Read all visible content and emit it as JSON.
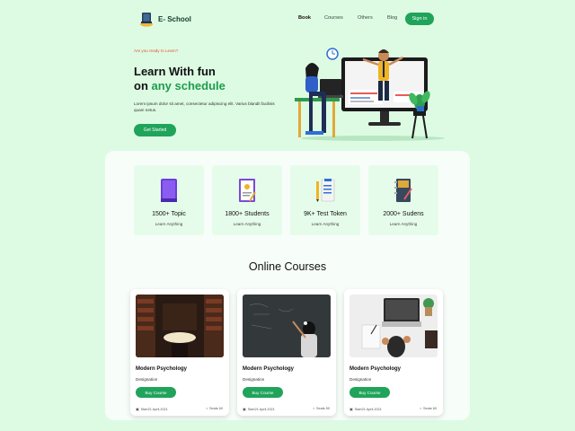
{
  "header": {
    "logo_text": "E- School",
    "nav": [
      "Book",
      "Courses",
      "Others",
      "Blog"
    ],
    "signin": "Sign in"
  },
  "hero": {
    "eyebrow": "Are you ready to Learn?",
    "title_line1": "Learn With fun",
    "title_on": "on ",
    "title_accent": "any schedule",
    "description": "Lorem ipsum dolor sit amet, consectetur adipiscing elit. Varius blandit facilisis quam netus.",
    "cta": "Get Started"
  },
  "stats": [
    {
      "value": "1500+ Topic",
      "sub": "Learn Anything",
      "icon": "book-icon"
    },
    {
      "value": "1800+ Students",
      "sub": "Learn Anything",
      "icon": "certificate-icon"
    },
    {
      "value": "9K+ Test Token",
      "sub": "Learn Anything",
      "icon": "test-paper-icon"
    },
    {
      "value": "2000+ Sudens",
      "sub": "Learn Anything",
      "icon": "notebook-icon"
    }
  ],
  "courses": {
    "title": "Online Courses",
    "items": [
      {
        "title": "Modern Psychology",
        "designation": "Designation",
        "buy": "Buy Course",
        "date": "Start21 April,2021",
        "seats": "Seats 60",
        "image": "library-reading-photo"
      },
      {
        "title": "Modern Psychology",
        "designation": "Designation",
        "buy": "Buy Course",
        "date": "Start21 April,2021",
        "seats": "Seats 50",
        "image": "chalkboard-girl-photo"
      },
      {
        "title": "Modern Psychology",
        "designation": "Designation",
        "buy": "Buy Course",
        "date": "Start21 April,2021",
        "seats": "Seats 60",
        "image": "laptop-desk-photo"
      }
    ]
  },
  "colors": {
    "background": "#ddfbe3",
    "accent": "#20a35a",
    "eyebrow": "#e5512f",
    "stat_card": "#e6fcea"
  }
}
